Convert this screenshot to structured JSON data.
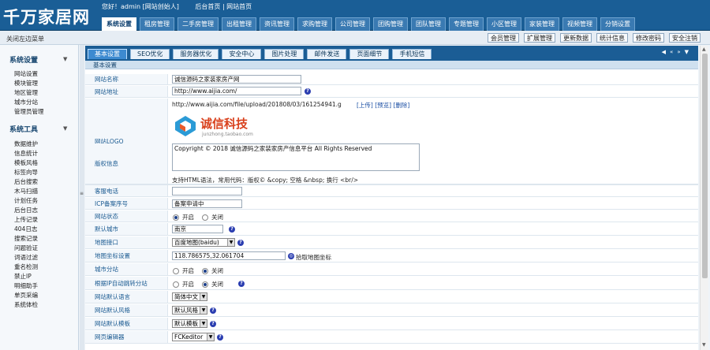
{
  "brand": {
    "logo": "千万家居网"
  },
  "userbar": {
    "greeting": "您好！admin [网站创始人]",
    "home": "后台首页 | 网站首页"
  },
  "nav": [
    "系统设置",
    "租房管理",
    "二手房管理",
    "出租管理",
    "资讯管理",
    "求购管理",
    "公司管理",
    "团购管理",
    "团队管理",
    "专题管理",
    "小区管理",
    "家装管理",
    "视频管理",
    "分销设置"
  ],
  "subbar": {
    "close_menu": "关闭左边菜单",
    "quick": [
      "会员管理",
      "扩展管理",
      "更新数据",
      "统计信息",
      "修改密码",
      "安全注销"
    ]
  },
  "sidebar": {
    "group1": "系统设置",
    "items1": [
      "网站设置",
      "模块管理",
      "地区管理",
      "城市分站",
      "管理员管理"
    ],
    "group2": "系统工具",
    "items2": [
      "数据维护",
      "信息统计",
      "模板风格",
      "标签向导",
      "后台搜索",
      "木马扫描",
      "计划任务",
      "后台日志",
      "上传记录",
      "404日志",
      "搜索记录",
      "问题验证",
      "词语过滤",
      "重名检测",
      "禁止IP",
      "明细助手",
      "单页采编",
      "系统体检"
    ]
  },
  "tabs": [
    "基本设置",
    "SEO优化",
    "服务器优化",
    "安全中心",
    "图片处理",
    "邮件发送",
    "页面细节",
    "手机短信"
  ],
  "tools": [
    "◀",
    "«",
    "»",
    "▼"
  ],
  "section_title": "基本设置",
  "form": {
    "site_name": {
      "label": "网站名称",
      "value": "诚信源码之家装家房产网"
    },
    "site_url": {
      "label": "网站地址",
      "value": "http://www.aijia.com/"
    },
    "site_logo": {
      "label": "网站LOGO",
      "path": "http://www.aijia.com/file/upload/201808/03/161254941.g",
      "links": "[上传] [预览] [删除]",
      "logo_text": "诚信科技",
      "logo_sub": "junzhong.taobao.com"
    },
    "copyright": {
      "label": "版权信息",
      "value": "Copyright © 2018 诚信源码之家装家房产信息平台 All Rights Reserved",
      "hint": "支持HTML语法，常用代码：版权© &copy; 空格 &nbsp; 换行 <br/>"
    },
    "phone": {
      "label": "客服电话",
      "value": ""
    },
    "icp": {
      "label": "ICP备案序号",
      "value": "备案申请中"
    },
    "status": {
      "label": "网站状态",
      "options": [
        "开启",
        "关闭"
      ],
      "selected": 0
    },
    "city": {
      "label": "默认城市",
      "value": "南京"
    },
    "map_api": {
      "label": "地图接口",
      "value": "百度地图(baidu)"
    },
    "map_coord": {
      "label": "地图坐标设置",
      "value": "118.786575,32.061704",
      "link": "拾取地图坐标"
    },
    "city_branch": {
      "label": "城市分站",
      "options": [
        "开启",
        "关闭"
      ],
      "selected": 1
    },
    "ip_jump": {
      "label": "根据IP自动跳转分站",
      "options": [
        "开启",
        "关闭"
      ],
      "selected": 1
    },
    "language": {
      "label": "网站默认语言",
      "value": "简体中文"
    },
    "style": {
      "label": "网站默认风格",
      "value": "默认风格"
    },
    "template": {
      "label": "网站默认模板",
      "value": "默认模板"
    },
    "editor": {
      "label": "网页编辑器",
      "value": "FCKeditor"
    }
  }
}
